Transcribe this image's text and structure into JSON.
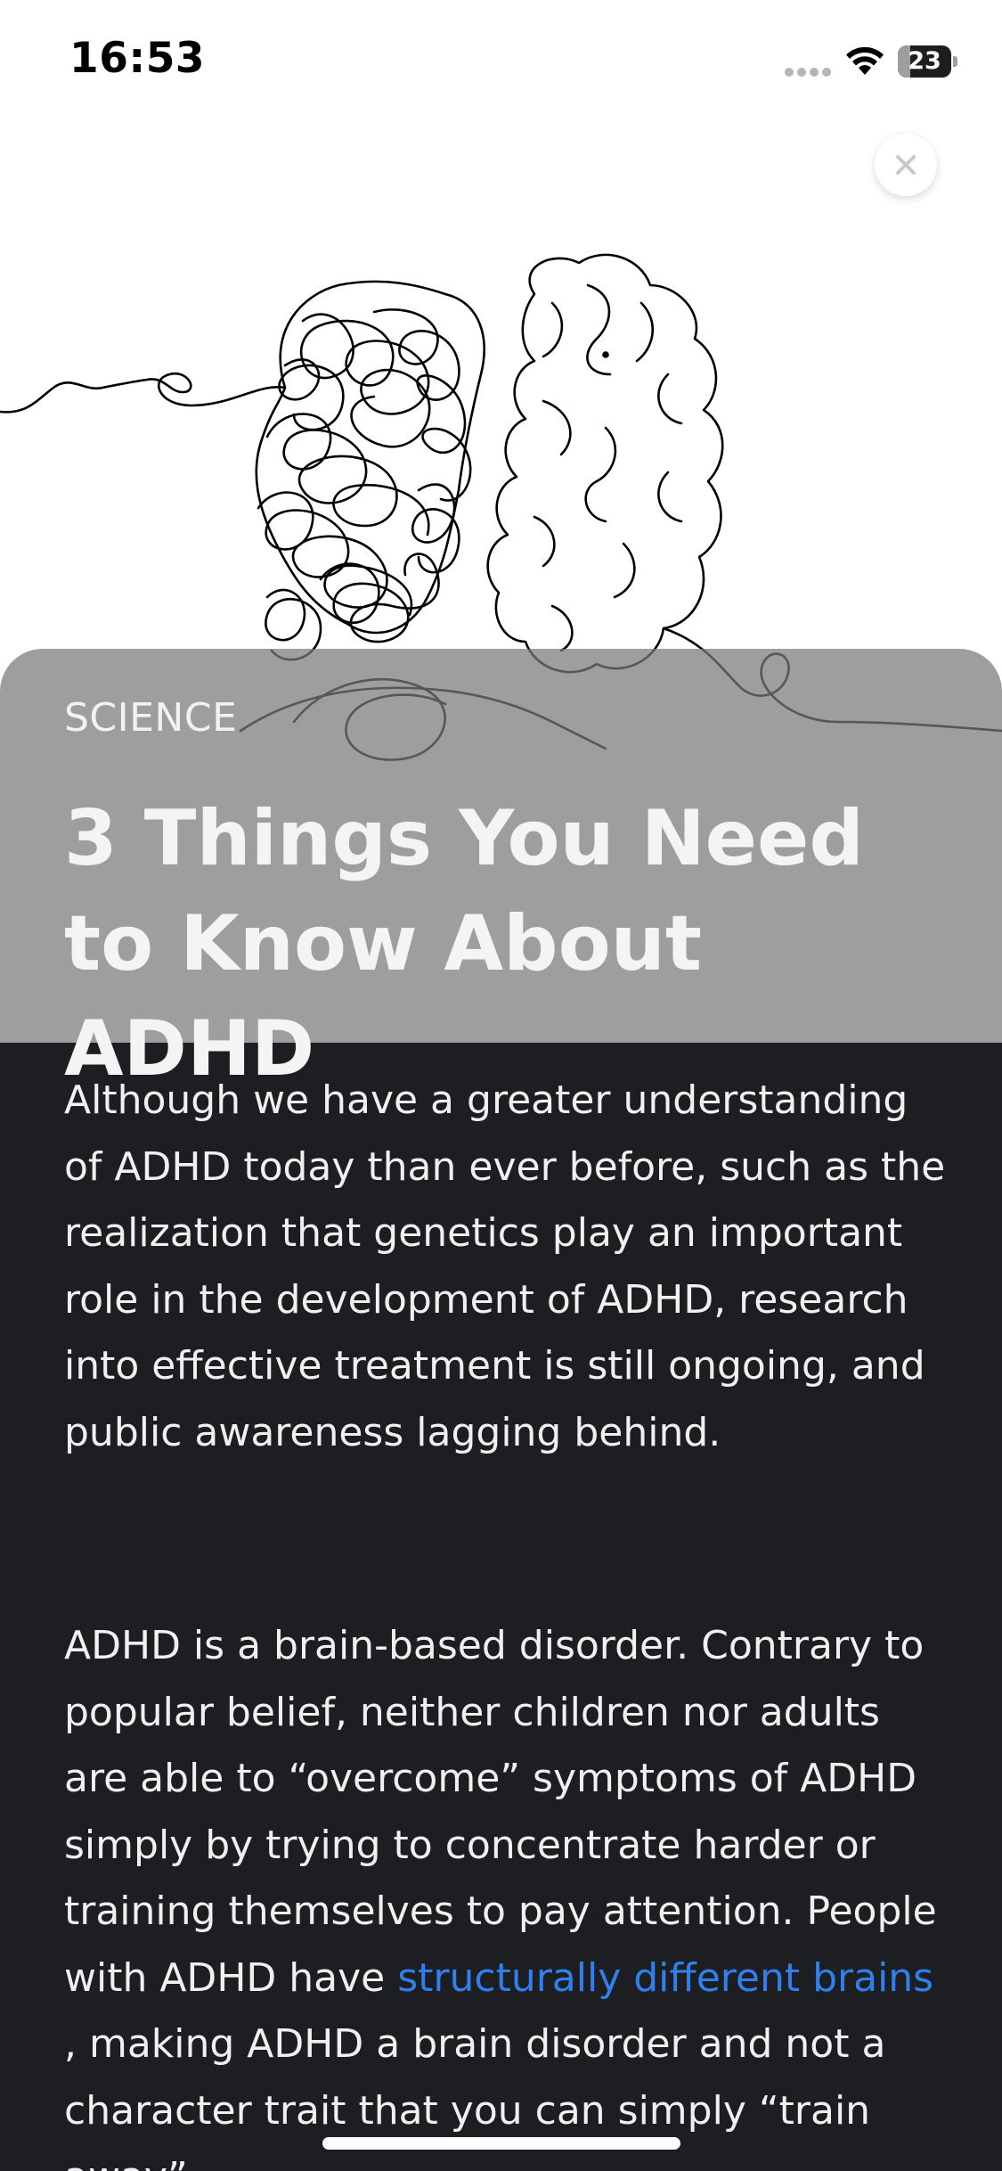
{
  "status_bar": {
    "time": "16:53",
    "battery_level": "23",
    "battery_fraction": 0.23
  },
  "icons": {
    "close": "close-icon",
    "wifi": "wifi-icon",
    "signal": "signal-dots-icon",
    "battery": "battery-icon"
  },
  "article": {
    "category": "SCIENCE",
    "title": "3 Things You Need to Know About ADHD",
    "paragraph_1": "Although we have a greater understanding of ADHD today than ever before, such as the realization that genetics play an important role in the development of ADHD, research into effective treatment is still ongoing, and public awareness lagging behind.",
    "paragraph_2_before_link": "ADHD is a brain-based disorder. Contrary to popular belief, neither children nor adults are able to “overcome” symptoms of ADHD simply by trying to concentrate harder or training themselves to pay attention. People with ADHD have ",
    "paragraph_2_link": "structurally different brains",
    "paragraph_2_after_link": " , making ADHD a brain disorder and not a character trait that you can simply “train away”."
  },
  "colors": {
    "body_background": "#1c1e22",
    "title_card": "#787878",
    "link": "#2f80ed",
    "text": "#f0f0f0"
  }
}
